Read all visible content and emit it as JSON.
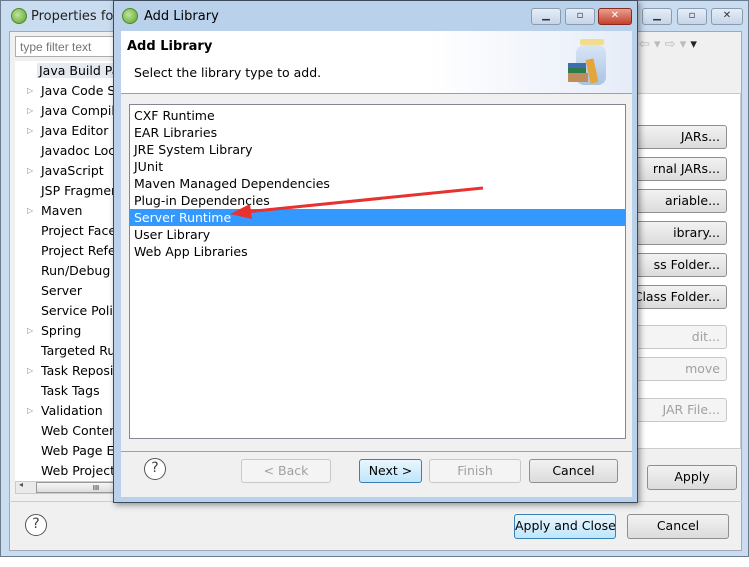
{
  "background_window": {
    "title": "Properties for",
    "filter_placeholder": "type filter text",
    "tree": [
      {
        "label": "Java Build Pa",
        "expandable": false,
        "selected": true
      },
      {
        "label": "Java Code St",
        "expandable": true
      },
      {
        "label": "Java Compile",
        "expandable": true
      },
      {
        "label": "Java Editor",
        "expandable": true
      },
      {
        "label": "Javadoc Loca",
        "expandable": false
      },
      {
        "label": "JavaScript",
        "expandable": true
      },
      {
        "label": "JSP Fragmen",
        "expandable": false
      },
      {
        "label": "Maven",
        "expandable": true
      },
      {
        "label": "Project Facet",
        "expandable": false
      },
      {
        "label": "Project Refer",
        "expandable": false
      },
      {
        "label": "Run/Debug S",
        "expandable": false
      },
      {
        "label": "Server",
        "expandable": false
      },
      {
        "label": "Service Polic",
        "expandable": false
      },
      {
        "label": "Spring",
        "expandable": true
      },
      {
        "label": "Targeted Ru",
        "expandable": false
      },
      {
        "label": "Task Reposit",
        "expandable": true
      },
      {
        "label": "Task Tags",
        "expandable": false
      },
      {
        "label": "Validation",
        "expandable": true
      },
      {
        "label": "Web Conten",
        "expandable": false
      },
      {
        "label": "Web Page E",
        "expandable": false
      },
      {
        "label": "Web Project",
        "expandable": false
      }
    ],
    "side_buttons": [
      {
        "label": "JARs...",
        "enabled": true
      },
      {
        "label": "rnal JARs...",
        "enabled": true
      },
      {
        "label": "ariable...",
        "enabled": true
      },
      {
        "label": "ibrary...",
        "enabled": true
      },
      {
        "label": "ss Folder...",
        "enabled": true
      },
      {
        "label": "Class Folder...",
        "enabled": true
      },
      {
        "label": "dit...",
        "enabled": false
      },
      {
        "label": "move",
        "enabled": false
      },
      {
        "label": "JAR File...",
        "enabled": false
      }
    ],
    "apply": "Apply",
    "apply_close": "Apply and Close",
    "cancel": "Cancel",
    "scroll_thumb": "III",
    "help": "?"
  },
  "dialog": {
    "title": "Add Library",
    "heading": "Add Library",
    "description": "Select the library type to add.",
    "items": [
      "CXF Runtime",
      "EAR Libraries",
      "JRE System Library",
      "JUnit",
      "Maven Managed Dependencies",
      "Plug-in Dependencies",
      "Server Runtime",
      "User Library",
      "Web App Libraries"
    ],
    "selected_index": 6,
    "buttons": {
      "back": "< Back",
      "next": "Next >",
      "finish": "Finish",
      "cancel": "Cancel"
    },
    "help": "?"
  },
  "annotation_color": "#e8322f",
  "selection_color": "#3399ff"
}
